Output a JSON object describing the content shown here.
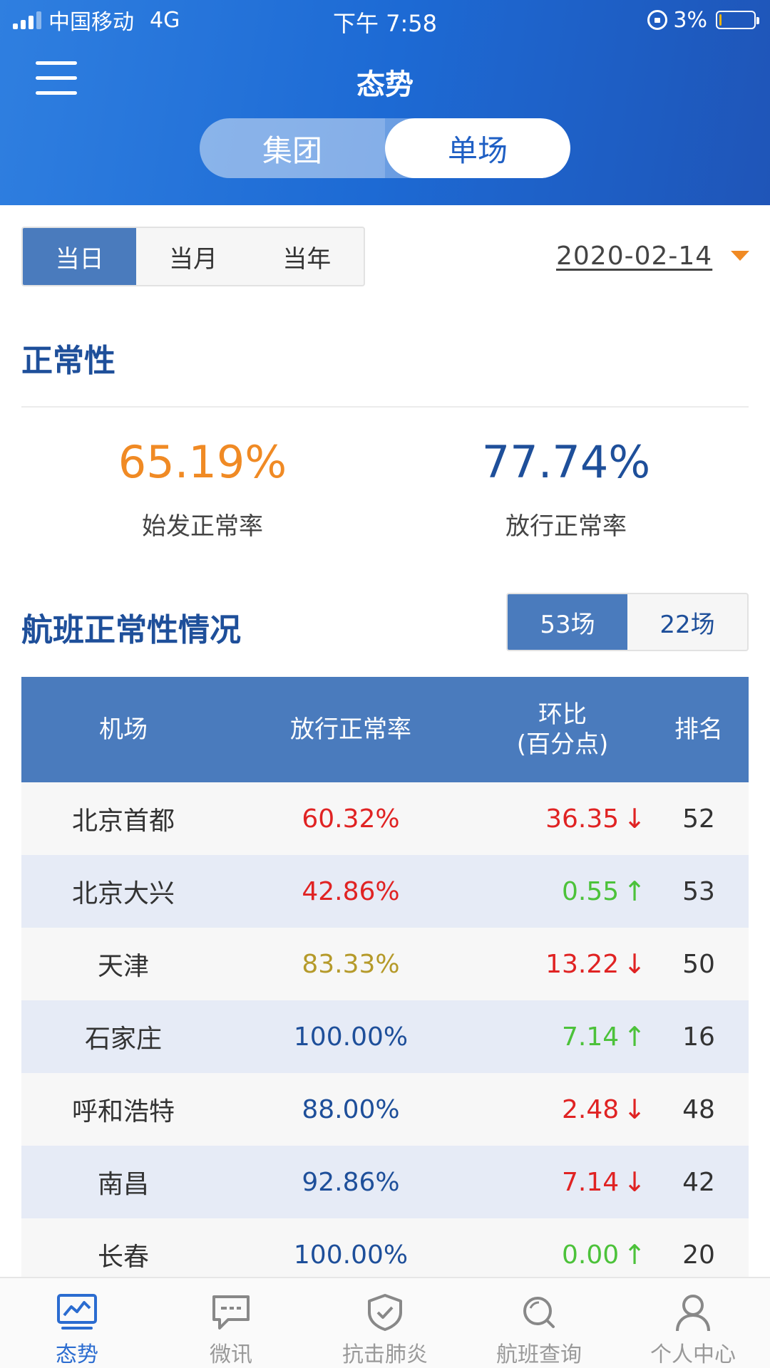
{
  "status_bar": {
    "carrier": "中国移动",
    "network": "4G",
    "time": "下午 7:58",
    "battery_text": "3%",
    "battery_level": 0.03
  },
  "header": {
    "title": "态势"
  },
  "scope_tabs": {
    "group": "集团",
    "single": "单场",
    "selected": "单场"
  },
  "period_tabs": {
    "day": "当日",
    "month": "当月",
    "year": "当年",
    "selected": "当日"
  },
  "date": "2020-02-14",
  "normality": {
    "title": "正常性",
    "departure_rate": {
      "value": "65.19%",
      "label": "始发正常率",
      "color": "#f08a24"
    },
    "release_rate": {
      "value": "77.74%",
      "label": "放行正常率",
      "color": "#1e4f9a"
    }
  },
  "flights": {
    "title": "航班正常性情况",
    "count_tabs": {
      "a": "53场",
      "b": "22场",
      "selected": "53场"
    },
    "headers": {
      "airport": "机场",
      "rate": "放行正常率",
      "change_line1": "环比",
      "change_line2": "(百分点)",
      "rank": "排名"
    },
    "rows": [
      {
        "airport": "北京首都",
        "rate": "60.32%",
        "rate_color": "#e02323",
        "change": "36.35",
        "direction": "down",
        "rank": "52"
      },
      {
        "airport": "北京大兴",
        "rate": "42.86%",
        "rate_color": "#e02323",
        "change": "0.55",
        "direction": "up",
        "rank": "53"
      },
      {
        "airport": "天津",
        "rate": "83.33%",
        "rate_color": "#b59a2a",
        "change": "13.22",
        "direction": "down",
        "rank": "50"
      },
      {
        "airport": "石家庄",
        "rate": "100.00%",
        "rate_color": "#1e4f9a",
        "change": "7.14",
        "direction": "up",
        "rank": "16"
      },
      {
        "airport": "呼和浩特",
        "rate": "88.00%",
        "rate_color": "#1e4f9a",
        "change": "2.48",
        "direction": "down",
        "rank": "48"
      },
      {
        "airport": "南昌",
        "rate": "92.86%",
        "rate_color": "#1e4f9a",
        "change": "7.14",
        "direction": "down",
        "rank": "42"
      },
      {
        "airport": "长春",
        "rate": "100.00%",
        "rate_color": "#1e4f9a",
        "change": "0.00",
        "direction": "up",
        "rank": "20"
      }
    ],
    "colors": {
      "down": "#e02323",
      "up": "#4cc23a"
    }
  },
  "tabbar": {
    "items": [
      {
        "label": "态势",
        "icon": "chart-monitor-icon",
        "active": true
      },
      {
        "label": "微讯",
        "icon": "chat-bubble-icon",
        "active": false
      },
      {
        "label": "抗击肺炎",
        "icon": "shield-check-icon",
        "active": false
      },
      {
        "label": "航班查询",
        "icon": "search-icon",
        "active": false
      },
      {
        "label": "个人中心",
        "icon": "user-icon",
        "active": false
      }
    ]
  }
}
